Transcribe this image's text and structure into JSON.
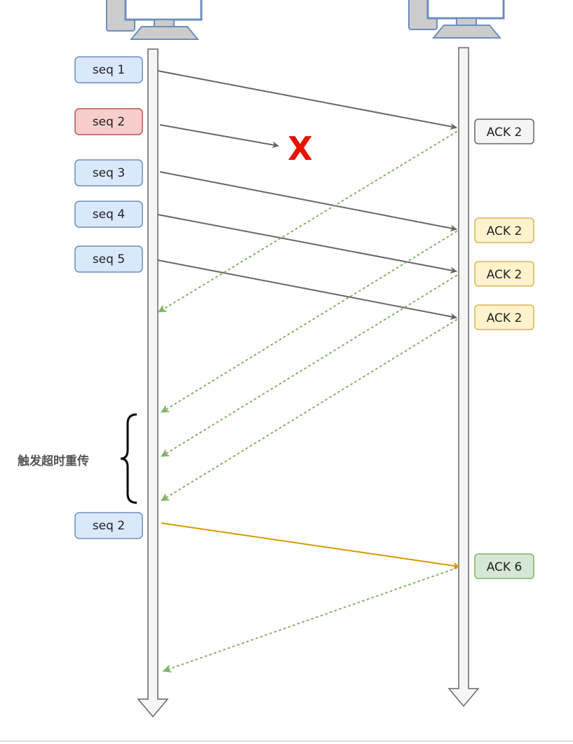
{
  "sender": {
    "packets": [
      {
        "label": "seq 1",
        "style": "blue"
      },
      {
        "label": "seq 2",
        "style": "red"
      },
      {
        "label": "seq 3",
        "style": "blue"
      },
      {
        "label": "seq 4",
        "style": "blue"
      },
      {
        "label": "seq 5",
        "style": "blue"
      },
      {
        "label": "seq 2",
        "style": "blue"
      }
    ]
  },
  "receiver": {
    "acks": [
      {
        "label": "ACK 2",
        "style": "white"
      },
      {
        "label": "ACK 2",
        "style": "yellow"
      },
      {
        "label": "ACK 2",
        "style": "yellow"
      },
      {
        "label": "ACK 2",
        "style": "yellow"
      },
      {
        "label": "ACK 6",
        "style": "green"
      }
    ]
  },
  "lost_marker": "X",
  "timeout_note": "触发超时重传",
  "colors": {
    "blue_fill": "#dae8fc",
    "blue_stroke": "#6c8ebf",
    "red_fill": "#f8cecc",
    "red_stroke": "#b85450",
    "white_fill": "#f5f5f5",
    "white_stroke": "#666666",
    "yellow_fill": "#fff2cc",
    "yellow_stroke": "#d6b656",
    "green_fill": "#d5e8d4",
    "green_stroke": "#82b366",
    "data_arrow": "#666666",
    "ack_arrow": "#82b366",
    "retransmit_arrow": "#d79b00",
    "lost": "#e51400",
    "lifeline_fill": "#f5f5f5",
    "lifeline_stroke": "#666666"
  }
}
